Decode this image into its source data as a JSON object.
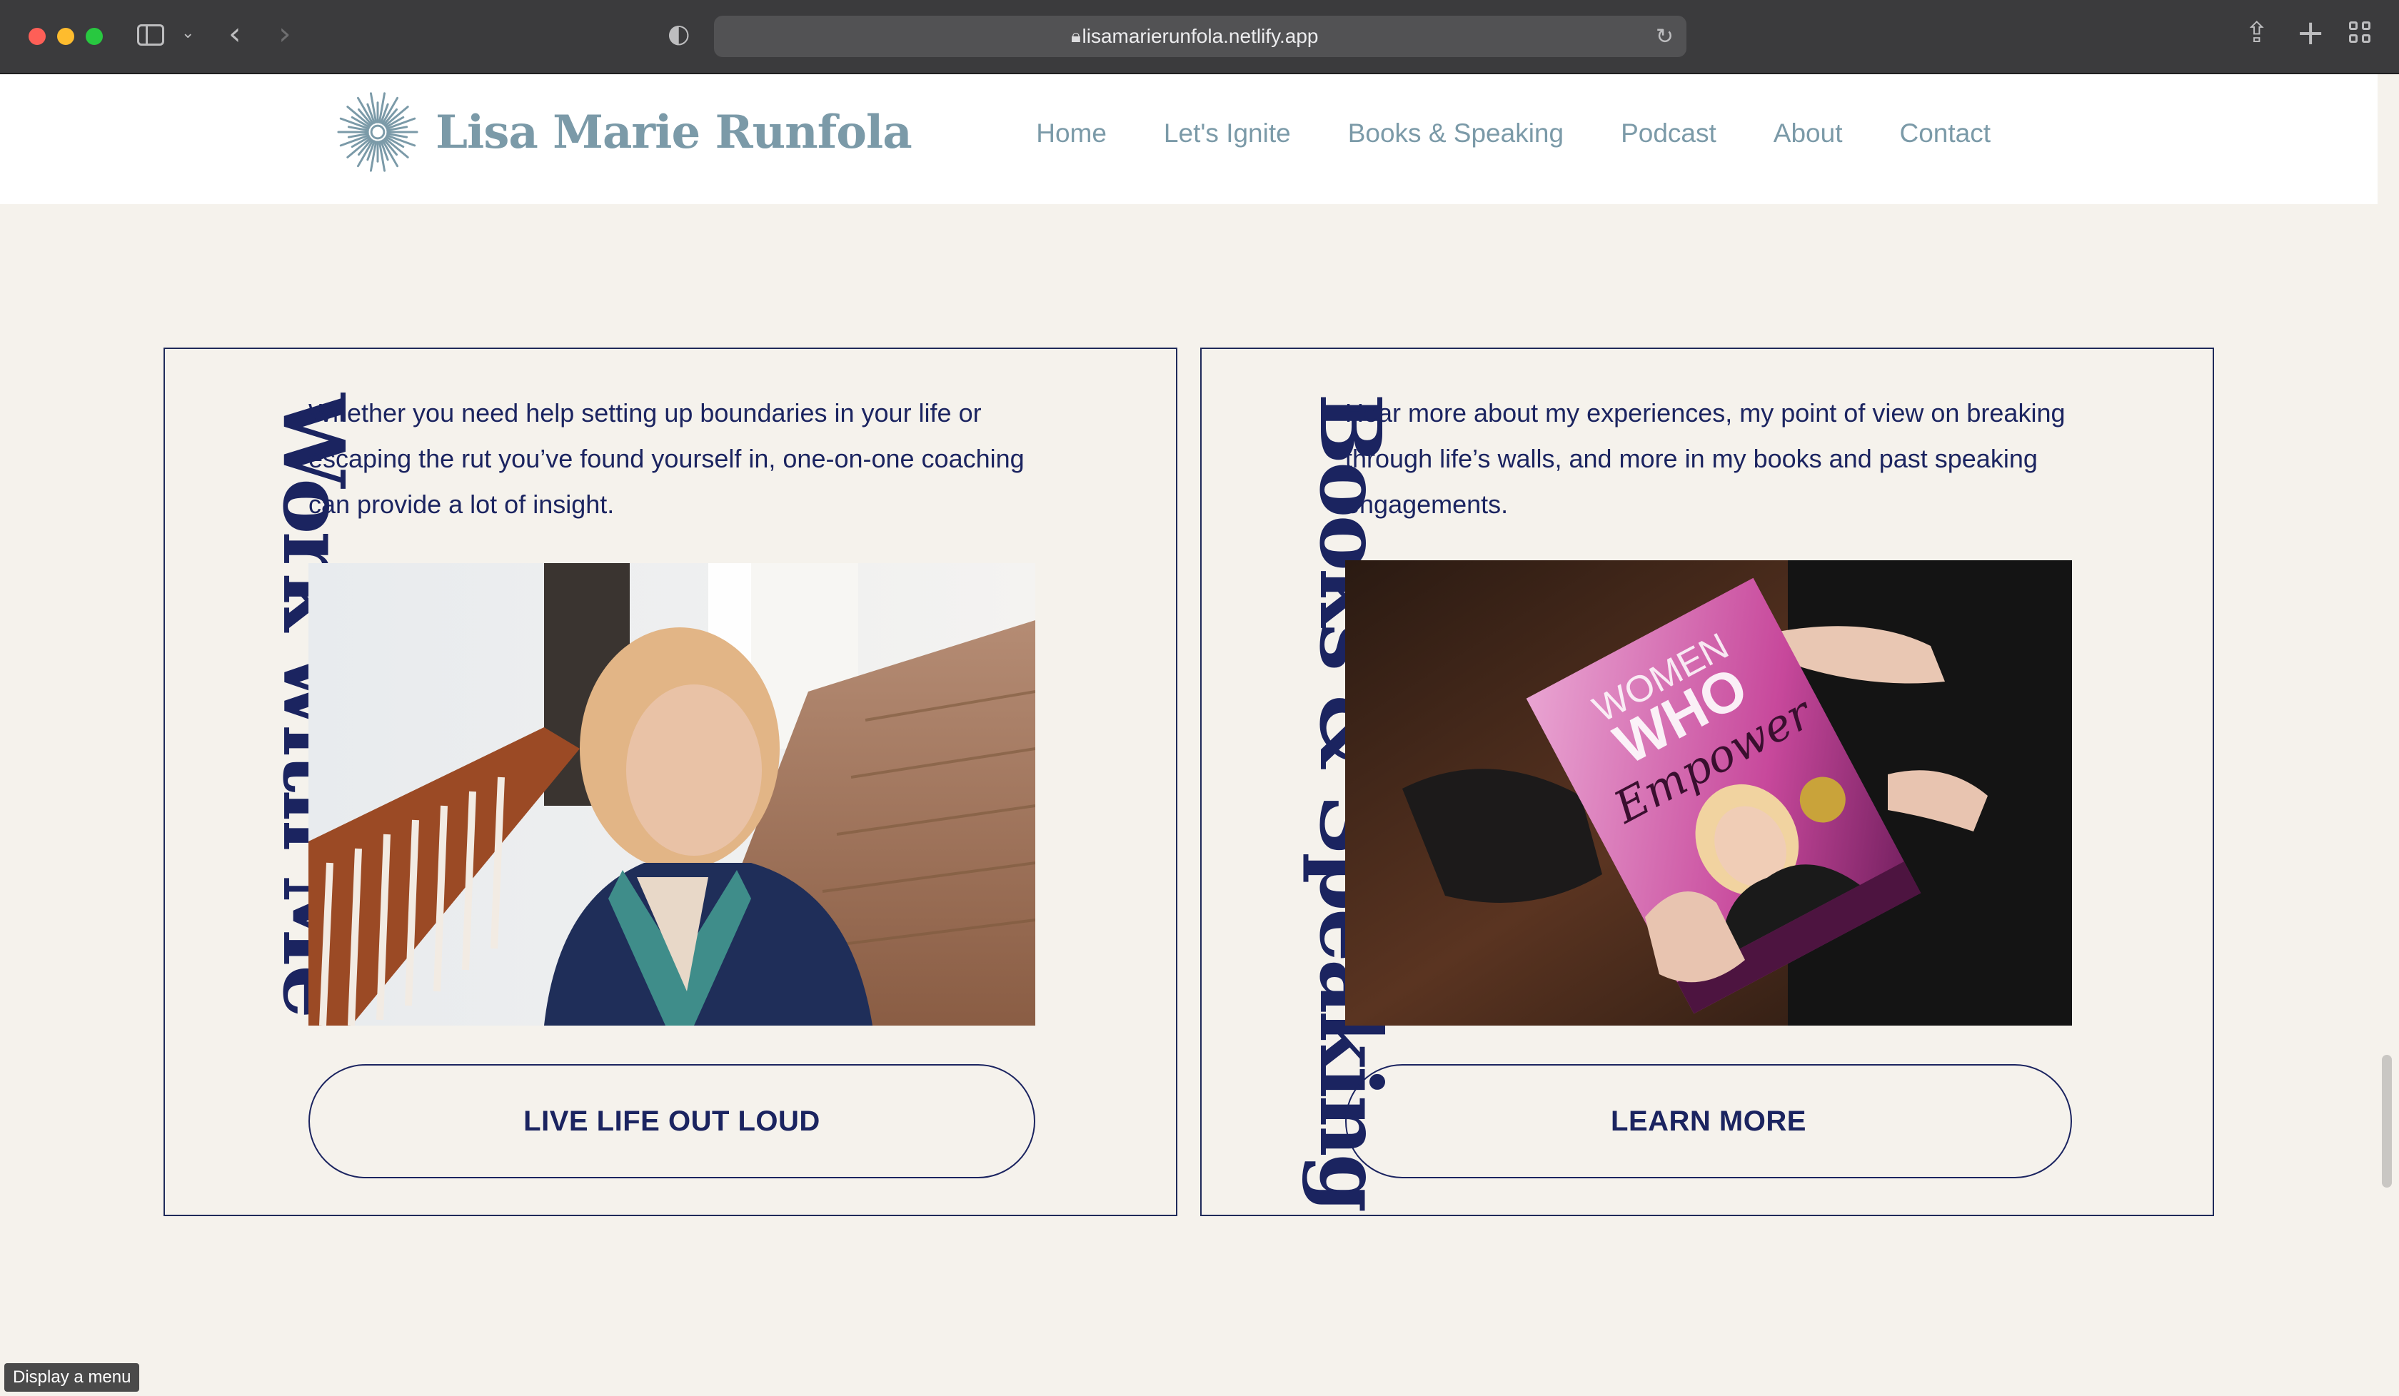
{
  "browser": {
    "url": "lisamarierunfola.netlify.app",
    "icons": [
      "sidebar-icon",
      "chevron-down-icon",
      "back-icon",
      "forward-icon",
      "shield-icon",
      "lock-icon",
      "reload-icon",
      "share-icon",
      "plus-icon",
      "tabs-grid-icon"
    ]
  },
  "site": {
    "logo_text": "Lisa Marie Runfola",
    "nav": [
      "Home",
      "Let's Ignite",
      "Books & Speaking",
      "Podcast",
      "About",
      "Contact"
    ],
    "brand_color": "#7b9aa8",
    "accent_color": "#1b2460"
  },
  "cards": [
    {
      "title": "Work with Me",
      "text": "Whether you need help setting up boundaries in your life or escaping the rut you’ve found yourself in, one-on-one coaching can provide a lot of insight.",
      "button": "LIVE LIFE OUT LOUD"
    },
    {
      "title": "Books & Speaking",
      "text": "Hear more about my experiences, my point of view on breaking through life’s walls, and more in my books and past speaking engagements.",
      "button": "LEARN MORE",
      "book": {
        "line1": "WOMEN",
        "line2": "WHO",
        "line3": "Empower"
      }
    }
  ],
  "tooltip": "Display a menu"
}
